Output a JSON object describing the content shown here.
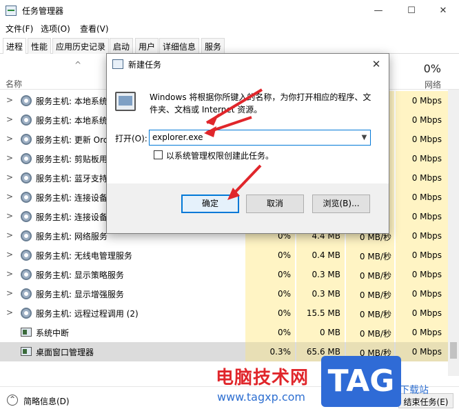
{
  "window": {
    "title": "任务管理器",
    "minimize": "—",
    "maximize": "☐",
    "close": "✕"
  },
  "menu": [
    "文件(F)",
    "选项(O)",
    "查看(V)"
  ],
  "tabs": [
    "进程",
    "性能",
    "应用历史记录",
    "启动",
    "用户",
    "详细信息",
    "服务"
  ],
  "header": {
    "sort_arrow": "^",
    "name": "名称",
    "net_pct": "0%",
    "net_label": "网络"
  },
  "rows": [
    {
      "name": "服务主机: 本地系统",
      "cpu": "",
      "mem": "",
      "disk": "",
      "net": "0 Mbps",
      "expand": true,
      "icon": "gear-icon"
    },
    {
      "name": "服务主机: 本地系统",
      "cpu": "",
      "mem": "",
      "disk": "",
      "net": "0 Mbps",
      "expand": true,
      "icon": "gear-icon"
    },
    {
      "name": "服务主机: 更新 Orc",
      "cpu": "",
      "mem": "",
      "disk": "",
      "net": "0 Mbps",
      "expand": true,
      "icon": "gear-icon"
    },
    {
      "name": "服务主机: 剪贴板用",
      "cpu": "",
      "mem": "",
      "disk": "",
      "net": "0 Mbps",
      "expand": true,
      "icon": "gear-icon"
    },
    {
      "name": "服务主机: 蓝牙支持",
      "cpu": "",
      "mem": "",
      "disk": "",
      "net": "0 Mbps",
      "expand": true,
      "icon": "gear-icon"
    },
    {
      "name": "服务主机: 连接设备",
      "cpu": "",
      "mem": "",
      "disk": "",
      "net": "0 Mbps",
      "expand": true,
      "icon": "gear-icon"
    },
    {
      "name": "服务主机: 连接设备",
      "cpu": "",
      "mem": "",
      "disk": "",
      "net": "0 Mbps",
      "expand": true,
      "icon": "gear-icon"
    },
    {
      "name": "服务主机: 网络服务",
      "cpu": "0%",
      "mem": "4.4 MB",
      "disk": "0 MB/秒",
      "net": "0 Mbps",
      "expand": true,
      "icon": "gear-icon"
    },
    {
      "name": "服务主机: 无线电管理服务",
      "cpu": "0%",
      "mem": "0.4 MB",
      "disk": "0 MB/秒",
      "net": "0 Mbps",
      "expand": true,
      "icon": "gear-icon"
    },
    {
      "name": "服务主机: 显示策略服务",
      "cpu": "0%",
      "mem": "0.3 MB",
      "disk": "0 MB/秒",
      "net": "0 Mbps",
      "expand": true,
      "icon": "gear-icon"
    },
    {
      "name": "服务主机: 显示增强服务",
      "cpu": "0%",
      "mem": "0.3 MB",
      "disk": "0 MB/秒",
      "net": "0 Mbps",
      "expand": true,
      "icon": "gear-icon"
    },
    {
      "name": "服务主机: 远程过程调用 (2)",
      "cpu": "0%",
      "mem": "15.5 MB",
      "disk": "0 MB/秒",
      "net": "0 Mbps",
      "expand": true,
      "icon": "gear-icon"
    },
    {
      "name": "系统中断",
      "cpu": "0%",
      "mem": "0 MB",
      "disk": "0 MB/秒",
      "net": "0 Mbps",
      "expand": false,
      "icon": "system-icon"
    },
    {
      "name": "桌面窗口管理器",
      "cpu": "0.3%",
      "mem": "65.6 MB",
      "disk": "0 MB/秒",
      "net": "0 Mbps",
      "expand": false,
      "icon": "desktop-window-icon",
      "selected": true
    }
  ],
  "footer": {
    "brief": "简略信息(D)",
    "end_task": "结束任务(E)"
  },
  "dialog": {
    "title": "新建任务",
    "close": "✕",
    "description": "Windows 将根据你所键入的名称，为你打开相应的程序、文件夹、文档或 Internet 资源。",
    "open_label": "打开(O):",
    "open_value": "explorer.exe",
    "admin_label": "以系统管理权限创建此任务。",
    "ok": "确定",
    "cancel": "取消",
    "browse": "浏览(B)..."
  },
  "watermark": {
    "line1": "电脑技术网",
    "line2": "www.tagxp.com",
    "logo": "TAG",
    "line3": "下载站"
  },
  "colors": {
    "accent": "#0078d7",
    "cell_highlight": "#fff4c4",
    "arrow": "#e0262b"
  }
}
